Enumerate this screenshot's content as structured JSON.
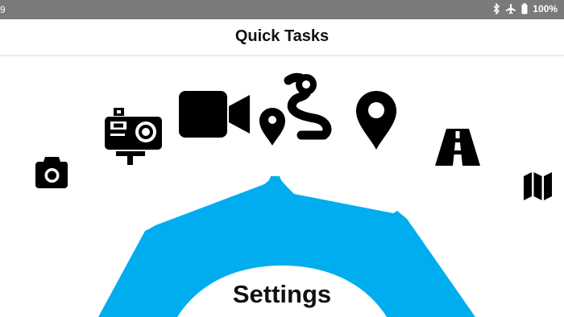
{
  "status_bar": {
    "time": "9",
    "battery": "100%",
    "icons": [
      "bluetooth-icon",
      "airplane-mode-icon",
      "battery-icon"
    ]
  },
  "app_bar": {
    "title": "Quick Tasks"
  },
  "dial": {
    "center_label": "Settings",
    "accent_color": "#00adef",
    "items": [
      "camera-icon",
      "action-camera-icon",
      "video-camera-icon",
      "route-icon",
      "location-pin-icon",
      "road-icon",
      "map-icon"
    ]
  }
}
